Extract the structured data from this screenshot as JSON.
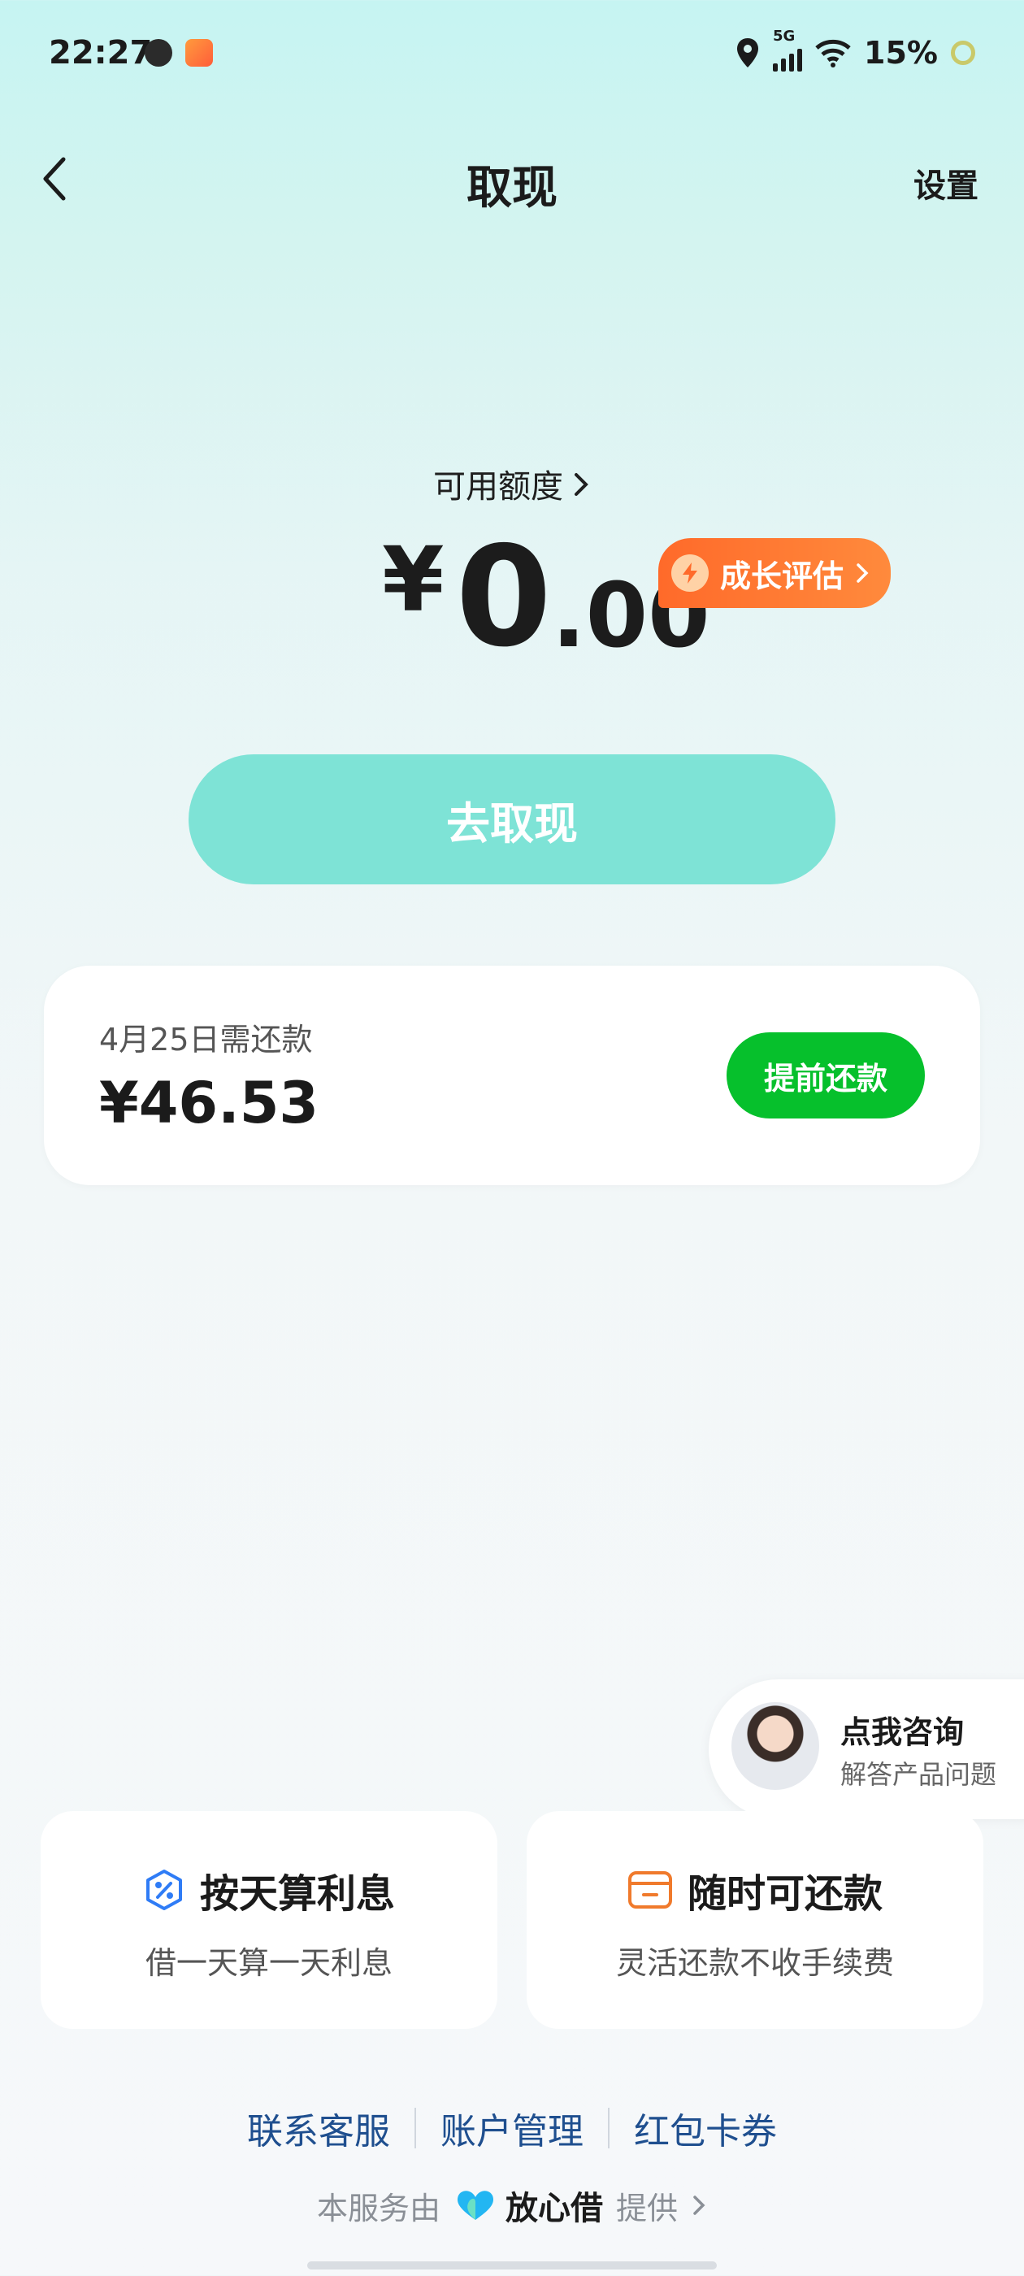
{
  "status_bar": {
    "time": "22:27",
    "network": "5G",
    "battery": "15%",
    "icons": [
      "location-icon",
      "signal-icon",
      "wifi-icon",
      "battery-icon"
    ]
  },
  "header": {
    "title": "取现",
    "settings_label": "设置",
    "back_icon": "chevron-left-icon"
  },
  "credit": {
    "label": "可用额度",
    "currency": "¥",
    "amount_int": "0",
    "amount_dec": ".00",
    "growth_badge": "成长评估"
  },
  "primary_action": {
    "label": "去取现"
  },
  "repay": {
    "due_label": "4月25日需还款",
    "amount": "¥46.53",
    "button_label": "提前还款"
  },
  "consult": {
    "title": "点我咨询",
    "subtitle": "解答产品问题"
  },
  "features": [
    {
      "title": "按天算利息",
      "subtitle": "借一天算一天利息",
      "icon": "percent-icon"
    },
    {
      "title": "随时可还款",
      "subtitle": "灵活还款不收手续费",
      "icon": "card-icon"
    }
  ],
  "footer": {
    "links": [
      "联系客服",
      "账户管理",
      "红包卡券"
    ],
    "provider_prefix": "本服务由",
    "provider_brand": "放心借",
    "provider_suffix": "提供"
  },
  "colors": {
    "primary_button": "#7ee3d6",
    "repay_button": "#06c02c",
    "growth_badge": "#ff6a2a",
    "link": "#1f4f8f"
  }
}
